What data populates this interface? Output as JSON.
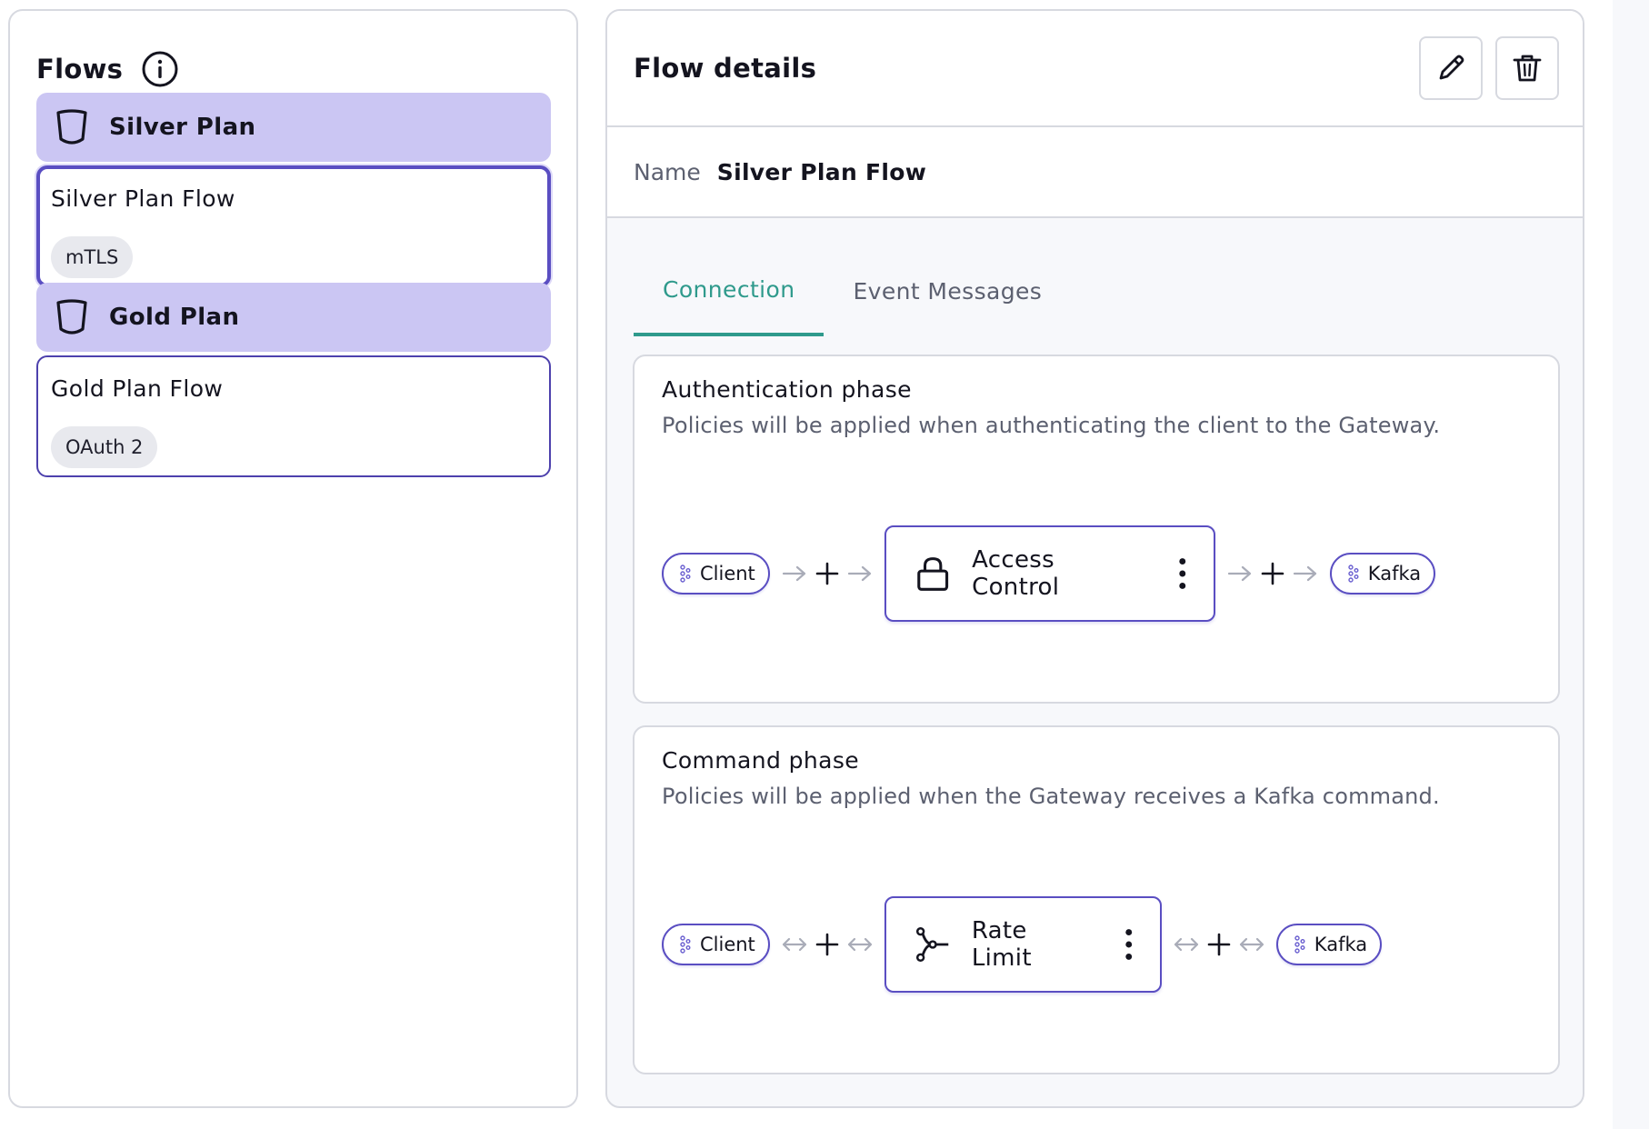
{
  "flows_panel": {
    "title": "Flows",
    "plans": [
      {
        "name": "Silver Plan",
        "flows": [
          {
            "name": "Silver Plan Flow",
            "tag": "mTLS",
            "selected": true
          }
        ]
      },
      {
        "name": "Gold Plan",
        "flows": [
          {
            "name": "Gold Plan Flow",
            "tag": "OAuth 2",
            "selected": false
          }
        ]
      }
    ]
  },
  "details": {
    "title": "Flow details",
    "name_label": "Name",
    "name_value": "Silver Plan Flow",
    "tabs": [
      {
        "label": "Connection",
        "active": true
      },
      {
        "label": "Event Messages",
        "active": false
      }
    ],
    "phases": [
      {
        "title": "Authentication phase",
        "description": "Policies will be applied when authenticating the client to the Gateway.",
        "source": "Client",
        "policy": "Access Control",
        "policy_icon": "lock-icon",
        "target": "Kafka",
        "arrow": "one-way"
      },
      {
        "title": "Command phase",
        "description": "Policies will be applied when the Gateway receives a Kafka command.",
        "source": "Client",
        "policy": "Rate Limit",
        "policy_icon": "branch-icon",
        "target": "Kafka",
        "arrow": "two-way"
      }
    ]
  },
  "colors": {
    "plan_header_bg": "#cbc6f3",
    "accent_purple": "#5a4ec2",
    "active_tab": "#2f9a8c",
    "border": "#d7d9e0",
    "muted_text": "#5c6070"
  }
}
